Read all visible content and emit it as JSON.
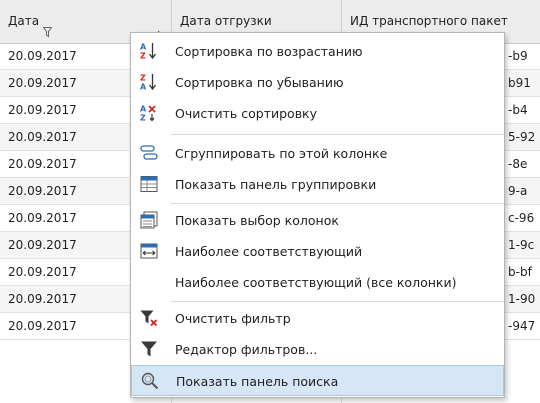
{
  "grid": {
    "columns": [
      {
        "label": "Дата"
      },
      {
        "label": "Дата отгрузки"
      },
      {
        "label": "ИД транспортного пакет"
      }
    ],
    "rows": [
      {
        "date": "20.09.2017",
        "tail": "-b9"
      },
      {
        "date": "20.09.2017",
        "tail": "b91"
      },
      {
        "date": "20.09.2017",
        "tail": "-b4"
      },
      {
        "date": "20.09.2017",
        "tail": "5-92"
      },
      {
        "date": "20.09.2017",
        "tail": "-8e"
      },
      {
        "date": "20.09.2017",
        "tail": "9-a"
      },
      {
        "date": "20.09.2017",
        "tail": "c-96"
      },
      {
        "date": "20.09.2017",
        "tail": "1-9c"
      },
      {
        "date": "20.09.2017",
        "tail": "b-bf"
      },
      {
        "date": "20.09.2017",
        "tail": "1-90"
      },
      {
        "date": "20.09.2017",
        "tail": "-947"
      }
    ]
  },
  "menu": {
    "items": [
      {
        "label": "Сортировка по возрастанию",
        "icon": "sort-ascending-icon"
      },
      {
        "label": "Сортировка по убыванию",
        "icon": "sort-descending-icon"
      },
      {
        "label": "Очистить сортировку",
        "icon": "clear-sorting-icon"
      },
      {
        "label": "Сгруппировать по этой колонке",
        "icon": "group-by-column-icon"
      },
      {
        "label": "Показать панель группировки",
        "icon": "group-panel-icon"
      },
      {
        "label": "Показать выбор колонок",
        "icon": "column-chooser-icon"
      },
      {
        "label": "Наиболее соответствующий",
        "icon": "best-fit-icon"
      },
      {
        "label": "Наиболее соответствующий (все колонки)",
        "icon": ""
      },
      {
        "label": "Очистить фильтр",
        "icon": "clear-filter-icon"
      },
      {
        "label": "Редактор фильтров...",
        "icon": "filter-editor-icon"
      },
      {
        "label": "Показать панель поиска",
        "icon": "search-panel-icon"
      }
    ],
    "highlighted_index": 10
  },
  "colors": {
    "highlight_bg": "#d5e6f7",
    "highlight_border": "#a9c9ea",
    "clear_red": "#d42020",
    "blue": "#2a6db5"
  }
}
